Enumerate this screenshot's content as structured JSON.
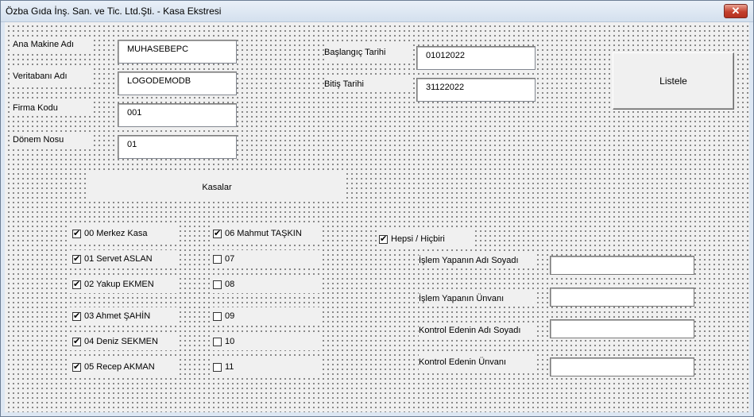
{
  "window": {
    "title": "Özba Gıda İnş. San. ve Tic. Ltd.Şti. - Kasa Ekstresi",
    "close_glyph": "✕"
  },
  "fields": {
    "ana_makine": {
      "label": "Ana Makine Adı",
      "value": "MUHASEBEPC"
    },
    "veritabani": {
      "label": "Veritabanı Adı",
      "value": "LOGODEMODB"
    },
    "firma_kodu": {
      "label": "Firma Kodu",
      "value": "001"
    },
    "donem_nosu": {
      "label": "Dönem Nosu",
      "value": "01"
    },
    "baslangic": {
      "label": "Başlangıç Tarihi",
      "value": "01012022"
    },
    "bitis": {
      "label": "Bitiş Tarihi",
      "value": "31122022"
    }
  },
  "buttons": {
    "listele": "Listele",
    "kasalar": "Kasalar"
  },
  "kasalar": [
    {
      "label": "00 Merkez Kasa",
      "checked": true
    },
    {
      "label": "01 Servet ASLAN",
      "checked": true
    },
    {
      "label": "02 Yakup EKMEN",
      "checked": true
    },
    {
      "label": "03 Ahmet ŞAHİN",
      "checked": true
    },
    {
      "label": "04 Deniz SEKMEN",
      "checked": true
    },
    {
      "label": "05 Recep AKMAN",
      "checked": true
    },
    {
      "label": "06 Mahmut TAŞKIN",
      "checked": true
    },
    {
      "label": "07",
      "checked": false
    },
    {
      "label": "08",
      "checked": false
    },
    {
      "label": "09",
      "checked": false
    },
    {
      "label": "10",
      "checked": false
    },
    {
      "label": "11",
      "checked": false
    }
  ],
  "hepsi": {
    "label": "Hepsi / Hiçbiri",
    "checked": true
  },
  "signatures": {
    "islem_adi": {
      "label": "İşlem Yapanın Adı Soyadı",
      "value": ""
    },
    "islem_unvan": {
      "label": "İşlem Yapanın Ünvanı",
      "value": ""
    },
    "kontrol_adi": {
      "label": "Kontrol Edenin Adı Soyadı",
      "value": ""
    },
    "kontrol_unvan": {
      "label": "Kontrol Edenin Ünvanı",
      "value": ""
    }
  }
}
